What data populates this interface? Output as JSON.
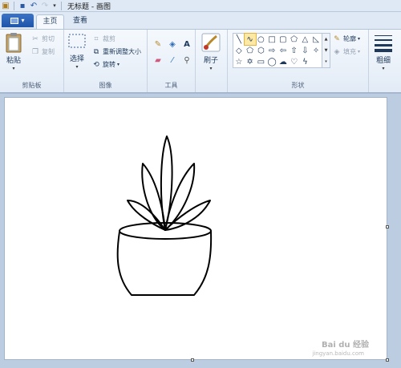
{
  "titlebar": {
    "title": "无标题 - 画图",
    "icons": [
      "app-icon",
      "save-icon",
      "undo-icon",
      "redo-icon",
      "customize-dropdown-icon"
    ]
  },
  "tabs": {
    "app_menu_icon": "paint-menu-icon",
    "home": "主页",
    "view": "查看"
  },
  "clipboard": {
    "paste": "粘贴",
    "cut": "剪切",
    "copy": "复制",
    "group_label": "剪贴板"
  },
  "image": {
    "select": "选择",
    "crop": "裁剪",
    "resize": "重新调整大小",
    "rotate": "旋转",
    "group_label": "图像"
  },
  "tools": {
    "group_label": "工具",
    "items": [
      "pencil-icon",
      "fill-icon",
      "text-icon",
      "eraser-icon",
      "color-picker-icon",
      "magnifier-icon"
    ],
    "text_glyph": "A"
  },
  "brushes": {
    "label": "刷子"
  },
  "shapes": {
    "group_label": "形状",
    "outline": "轮廓",
    "fill": "填充",
    "selected_shape": "curve"
  },
  "size": {
    "label": "粗细"
  },
  "watermark": {
    "text": "Bai du 经验",
    "sub": "jingyan.baidu.com"
  },
  "colors": {
    "ribbon_bg": "#e2ebf6",
    "canvas_bg": "#ffffff",
    "workspace_bg": "#bccde1",
    "app_menu": "#1f55a8",
    "selection_highlight": "#fde9a4"
  }
}
